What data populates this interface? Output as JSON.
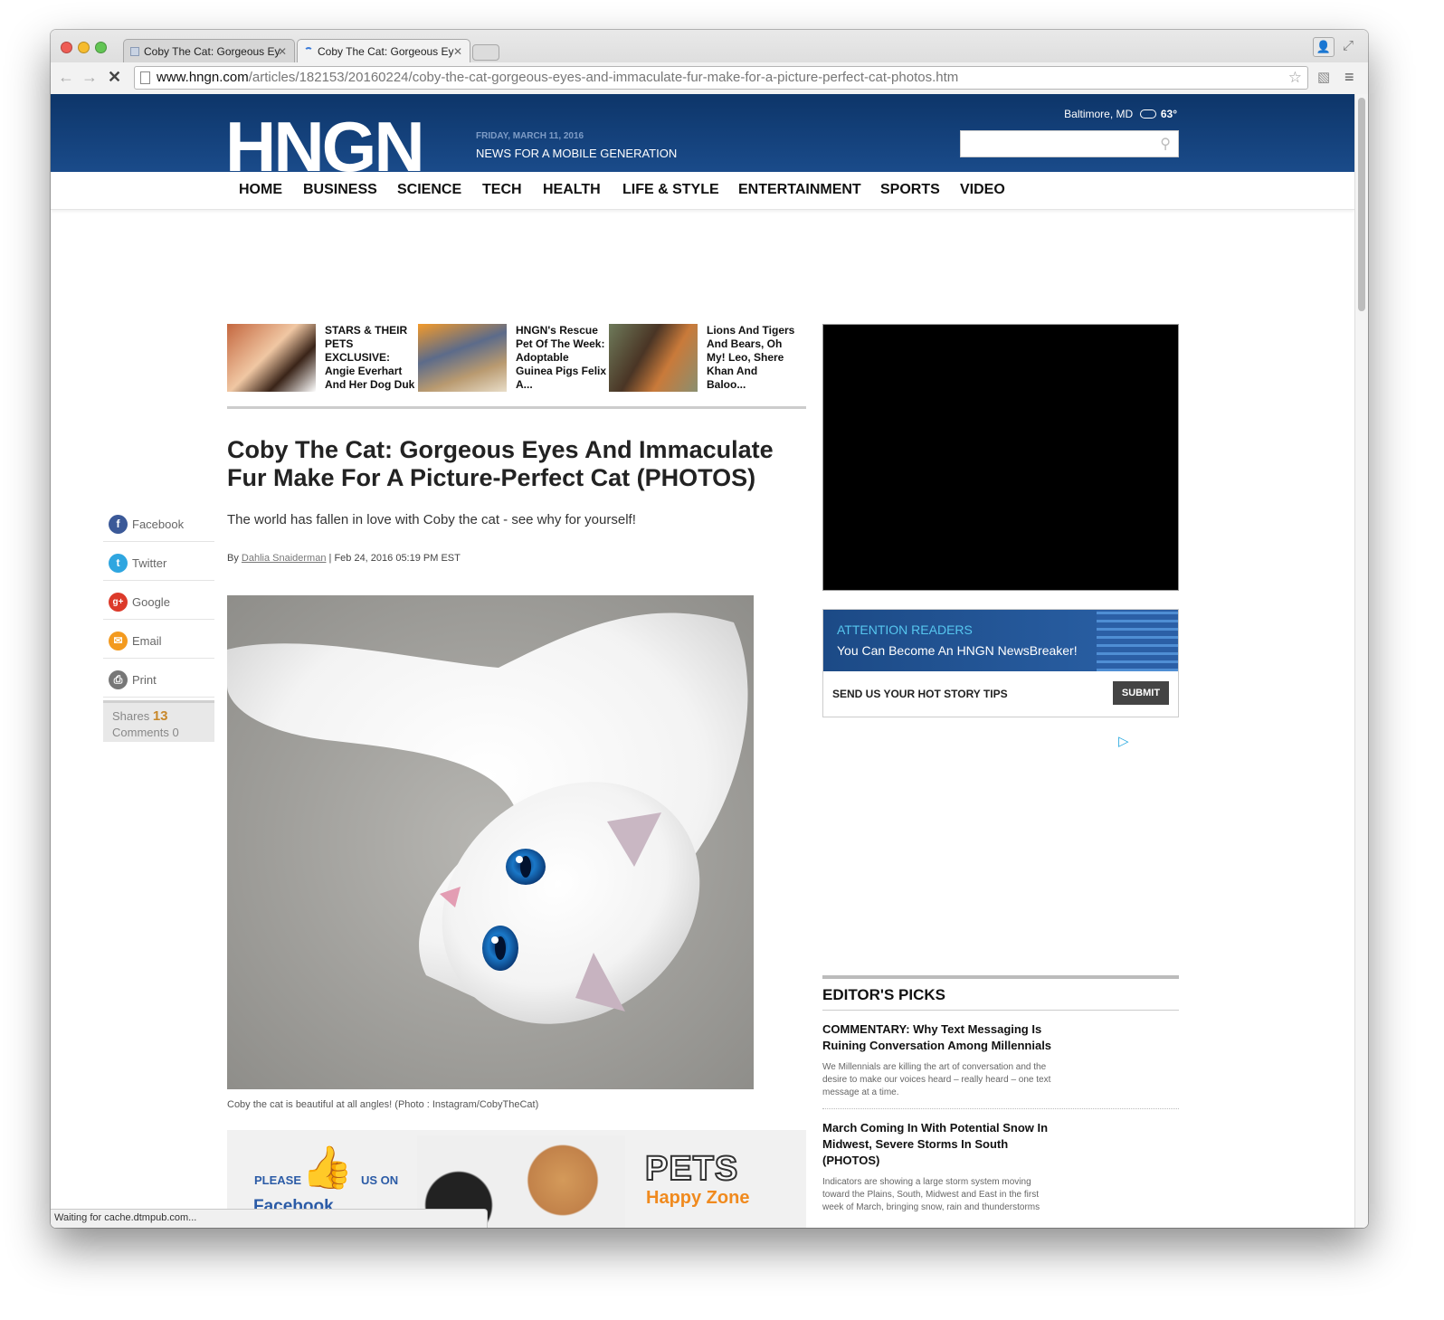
{
  "browser": {
    "tabs": [
      {
        "label": "Coby The Cat: Gorgeous Ey",
        "active": false
      },
      {
        "label": "Coby The Cat: Gorgeous Ey",
        "active": true
      }
    ],
    "url_domain": "www.hngn.com",
    "url_path": "/articles/182153/20160224/coby-the-cat-gorgeous-eyes-and-immaculate-fur-make-for-a-picture-perfect-cat-photos.htm",
    "status": "Waiting for cache.dtmpub.com..."
  },
  "header": {
    "logo": "HNGN",
    "date": "FRIDAY, MARCH 11, 2016",
    "tagline": "NEWS FOR A MOBILE GENERATION",
    "weather": "Baltimore, MD",
    "temp": "63°",
    "search_placeholder": ""
  },
  "nav": [
    "HOME",
    "BUSINESS",
    "SCIENCE",
    "TECH",
    "HEALTH",
    "LIFE & STYLE",
    "ENTERTAINMENT",
    "SPORTS",
    "VIDEO"
  ],
  "related": [
    {
      "text": "STARS & THEIR PETS EXCLUSIVE: Angie Everhart And Her Dog Duk"
    },
    {
      "text": "HNGN's Rescue Pet Of The Week: Adoptable Guinea Pigs Felix A..."
    },
    {
      "text": "Lions And Tigers And Bears, Oh My! Leo, Shere Khan And Baloo..."
    }
  ],
  "article": {
    "title": "Coby The Cat: Gorgeous Eyes And Immaculate Fur Make For A Picture-Perfect Cat (PHOTOS)",
    "subtitle": "The world has fallen in love with Coby the cat - see why for yourself!",
    "by": "By",
    "author": "Dahlia Snaiderman",
    "date": " | Feb 24, 2016 05:19 PM EST",
    "caption": "Coby the cat is beautiful at all angles! (Photo : Instagram/CobyTheCat)"
  },
  "share": {
    "items": [
      {
        "label": "Facebook",
        "icon": "facebook-icon",
        "color": "#3b5998",
        "glyph": "f"
      },
      {
        "label": "Twitter",
        "icon": "twitter-icon",
        "color": "#2fa6e0",
        "glyph": "t"
      },
      {
        "label": "Google",
        "icon": "google-plus-icon",
        "color": "#dc3a2a",
        "glyph": "g+"
      },
      {
        "label": "Email",
        "icon": "email-icon",
        "color": "#f39a1f",
        "glyph": "✉"
      },
      {
        "label": "Print",
        "icon": "print-icon",
        "color": "#777777",
        "glyph": "⎙"
      }
    ],
    "shares_label": "Shares",
    "shares_count": "13",
    "comments_label": "Comments",
    "comments_count": "0"
  },
  "pets_ad": {
    "please": "PLEASE",
    "us_on": "US ON",
    "facebook": "Facebook",
    "pets": "PETS",
    "happy_zone": "Happy Zone"
  },
  "attention": {
    "heading": "ATTENTION READERS",
    "sub": "You Can Become An HNGN NewsBreaker!",
    "tips": "SEND US YOUR HOT STORY TIPS",
    "submit": "SUBMIT"
  },
  "editors_picks": {
    "heading": "EDITOR'S PICKS",
    "items": [
      {
        "headline": "COMMENTARY: Why Text Messaging Is Ruining Conversation Among Millennials",
        "summary": "We Millennials are killing the art of conversation and the desire to make our voices heard – really heard – one text message at a time."
      },
      {
        "headline": "March Coming In With Potential Snow In Midwest, Severe Storms In South (PHOTOS)",
        "summary": "Indicators are showing a large storm system moving toward the Plains, South, Midwest and East in the first week of March, bringing snow, rain and thunderstorms"
      }
    ]
  }
}
